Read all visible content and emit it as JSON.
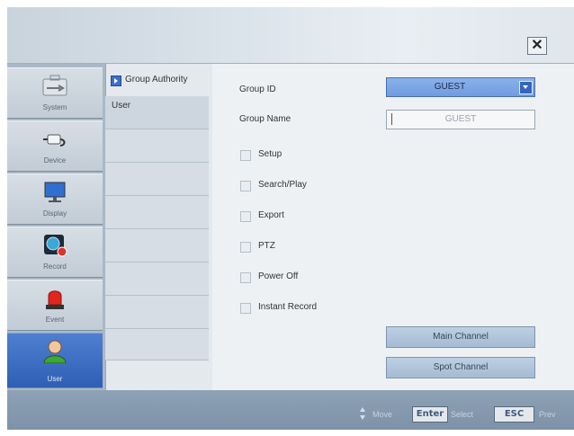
{
  "window": {
    "close_label": "✕"
  },
  "sidebar": {
    "items": [
      {
        "label": "System",
        "icon": "wrench-icon",
        "active": false
      },
      {
        "label": "Device",
        "icon": "device-icon",
        "active": false
      },
      {
        "label": "Display",
        "icon": "monitor-icon",
        "active": false
      },
      {
        "label": "Record",
        "icon": "record-icon",
        "active": false
      },
      {
        "label": "Event",
        "icon": "alarm-light-icon",
        "active": false
      },
      {
        "label": "User",
        "icon": "user-icon",
        "active": true
      }
    ]
  },
  "menu": {
    "header": "Group Authority",
    "items": [
      "User",
      "",
      "",
      "",
      "",
      "",
      "",
      ""
    ]
  },
  "form": {
    "group_id_label": "Group ID",
    "group_id_value": "GUEST",
    "group_name_label": "Group Name",
    "group_name_value": "GUEST",
    "permissions": [
      {
        "label": "Setup",
        "checked": false
      },
      {
        "label": "Search/Play",
        "checked": false
      },
      {
        "label": "Export",
        "checked": false
      },
      {
        "label": "PTZ",
        "checked": false
      },
      {
        "label": "Power Off",
        "checked": false
      },
      {
        "label": "Instant Record",
        "checked": false
      }
    ],
    "main_channel_label": "Main Channel",
    "spot_channel_label": "Spot Channel"
  },
  "footer": {
    "move_label": "Move",
    "enter_key": "Enter",
    "select_label": "Select",
    "esc_key": "ESC",
    "prev_label": "Prev"
  },
  "colors": {
    "accent": "#3565bf",
    "active_nav": "#2f5fb5",
    "footer": "#8ea2b6"
  }
}
